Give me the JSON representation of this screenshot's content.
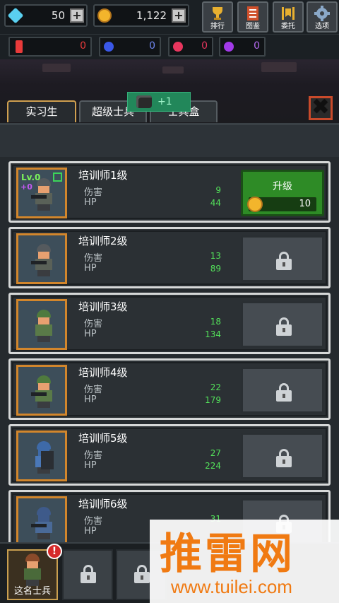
{
  "topbar": {
    "diamonds": "50",
    "coins": "1,122",
    "menu": [
      {
        "label": "排行",
        "icon": "trophy-icon"
      },
      {
        "label": "图鉴",
        "icon": "book-icon"
      },
      {
        "label": "委托",
        "icon": "banner-icon"
      },
      {
        "label": "选项",
        "icon": "gear-icon"
      }
    ]
  },
  "gems": [
    {
      "value": "0",
      "color": "#e83a3a",
      "icon": "red-gem-icon"
    },
    {
      "value": "0",
      "color": "#3a58e8",
      "icon": "blue-gem-icon"
    },
    {
      "value": "0",
      "color": "#e8365e",
      "icon": "pink-gem-icon"
    },
    {
      "value": "0",
      "color": "#a23ae8",
      "icon": "purple-gem-icon"
    }
  ],
  "tabs": [
    "实习生",
    "超级士兵",
    "士兵盒"
  ],
  "toast": "+1",
  "close_glyph": "✖",
  "list": {
    "damage_label": "伤害",
    "hp_label": "HP",
    "upgrade_label": "升级",
    "upgrade_cost": "10",
    "level_badge": "Lv.0",
    "plus_badge": "+0",
    "trainers": [
      {
        "name": "培训师1级",
        "damage": "9",
        "hp": "44",
        "unlocked": true,
        "helmet": "#555a5e"
      },
      {
        "name": "培训师2级",
        "damage": "13",
        "hp": "89",
        "unlocked": false,
        "helmet": "#555a5e"
      },
      {
        "name": "培训师3级",
        "damage": "18",
        "hp": "134",
        "unlocked": false,
        "helmet": "#4f7a3e"
      },
      {
        "name": "培训师4级",
        "damage": "22",
        "hp": "179",
        "unlocked": false,
        "helmet": "#4f7a3e"
      },
      {
        "name": "培训师5级",
        "damage": "27",
        "hp": "224",
        "unlocked": false,
        "helmet": "#3e6aa8"
      },
      {
        "name": "培训师6级",
        "damage": "31",
        "hp": "",
        "unlocked": false,
        "helmet": "#3e5a8a"
      }
    ]
  },
  "bottom": {
    "selected_label": "这名士兵",
    "alert": "!"
  },
  "watermark": {
    "text": "推雷网",
    "url": "www.tuilei.com"
  }
}
